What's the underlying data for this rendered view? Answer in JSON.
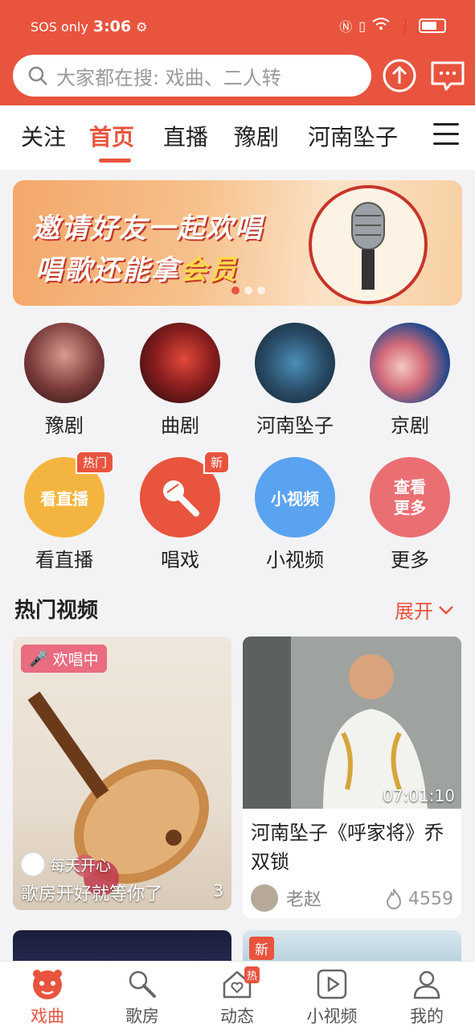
{
  "status_bar": {
    "carrier": "SOS only",
    "time": "3:06"
  },
  "search": {
    "placeholder": "大家都在搜: 戏曲、二人转"
  },
  "tabs": [
    {
      "label": "关注"
    },
    {
      "label": "首页"
    },
    {
      "label": "直播"
    },
    {
      "label": "豫剧"
    },
    {
      "label": "河南坠子"
    }
  ],
  "banner": {
    "line1": "邀请好友一起欢唱",
    "line2_prefix": "唱歌还能拿",
    "line2_highlight": "会员"
  },
  "genres": [
    {
      "label": "豫剧"
    },
    {
      "label": "曲剧"
    },
    {
      "label": "河南坠子"
    },
    {
      "label": "京剧"
    }
  ],
  "actions": [
    {
      "circle_text": "看直播",
      "label": "看直播",
      "badge": "热门",
      "color": "#f4b540"
    },
    {
      "circle_text": "",
      "label": "唱戏",
      "badge": "新",
      "color": "#e8543e"
    },
    {
      "circle_text": "小视频",
      "label": "小视频",
      "badge": "",
      "color": "#5aa3f0"
    },
    {
      "circle_text": "查看更多",
      "label": "更多",
      "badge": "",
      "color": "#ea6f73"
    }
  ],
  "section": {
    "title": "热门视频",
    "more": "展开"
  },
  "videos": [
    {
      "tag": "欢唱中",
      "owner": "每天开心",
      "title": "歌房开好就等你了",
      "count": "3"
    },
    {
      "duration": "07:01:10",
      "title": "河南坠子《呼家将》乔双锁",
      "author": "老赵",
      "heat": "4559"
    }
  ],
  "more_cards": [
    {
      "tag": ""
    },
    {
      "tag": "新"
    }
  ],
  "bottom_nav": [
    {
      "label": "戏曲",
      "icon": "opera-mask-icon",
      "badge": ""
    },
    {
      "label": "歌房",
      "icon": "microphone-icon",
      "badge": ""
    },
    {
      "label": "动态",
      "icon": "home-heart-icon",
      "badge": "热"
    },
    {
      "label": "小视频",
      "icon": "play-icon",
      "badge": ""
    },
    {
      "label": "我的",
      "icon": "user-icon",
      "badge": ""
    }
  ],
  "colors": {
    "brand": "#e8543e",
    "background": "#f3f3f5"
  }
}
